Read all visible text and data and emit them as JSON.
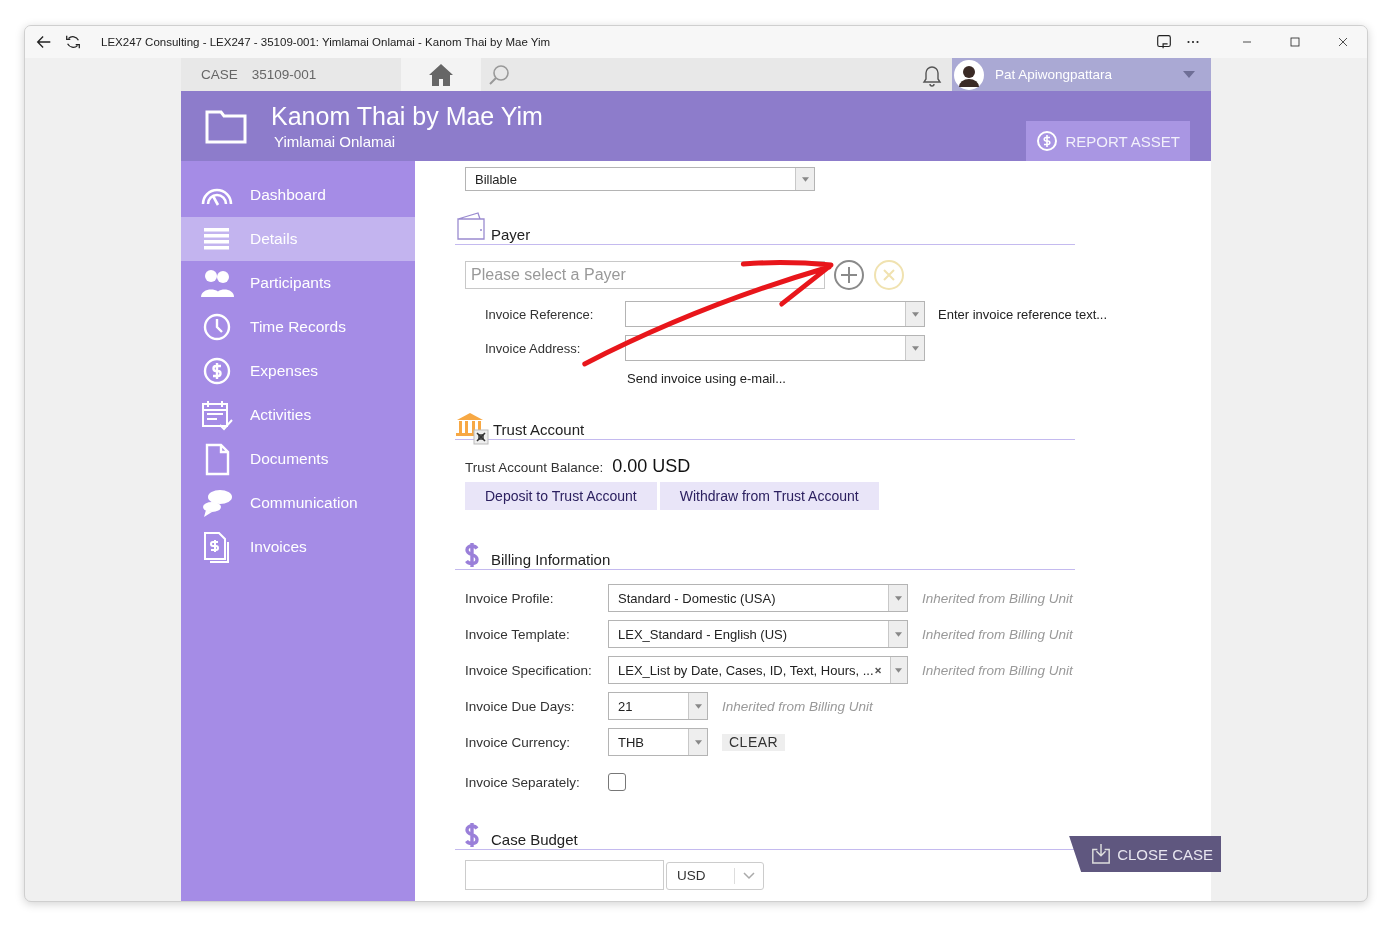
{
  "window": {
    "title": "LEX247 Consulting - LEX247 - 35109-001: Yimlamai Onlamai - Kanom Thai by Mae Yim"
  },
  "topbar": {
    "case_label": "CASE",
    "case_number": "35109-001",
    "user": "Pat Apiwongpattara"
  },
  "header": {
    "title": "Kanom Thai by Mae Yim",
    "subtitle": "Yimlamai Onlamai",
    "action": "REPORT ASSET"
  },
  "sidebar": {
    "items": [
      {
        "label": "Dashboard",
        "selected": false
      },
      {
        "label": "Details",
        "selected": true
      },
      {
        "label": "Participants",
        "selected": false
      },
      {
        "label": "Time Records",
        "selected": false
      },
      {
        "label": "Expenses",
        "selected": false
      },
      {
        "label": "Activities",
        "selected": false
      },
      {
        "label": "Documents",
        "selected": false
      },
      {
        "label": "Communication",
        "selected": false
      },
      {
        "label": "Invoices",
        "selected": false
      }
    ]
  },
  "billing_type": {
    "value": "Billable"
  },
  "payer": {
    "title": "Payer",
    "placeholder": "Please select a Payer",
    "fields": [
      {
        "label": "Invoice Reference:",
        "hint": "Enter invoice reference text..."
      },
      {
        "label": "Invoice Address:"
      }
    ],
    "email_link": "Send invoice using e-mail..."
  },
  "trust": {
    "title": "Trust Account",
    "balance_label": "Trust Account Balance:",
    "balance": "0.00 USD",
    "buttons": [
      "Deposit to Trust Account",
      "Withdraw from Trust Account"
    ]
  },
  "billing": {
    "title": "Billing Information",
    "rows": [
      {
        "kind": "wide",
        "label": "Invoice Profile:",
        "value": "Standard - Domestic (USA)",
        "note": "Inherited from Billing Unit"
      },
      {
        "kind": "wide",
        "label": "Invoice Template:",
        "value": "LEX_Standard - English (US)",
        "note": "Inherited from Billing Unit"
      },
      {
        "kind": "wide_clear",
        "label": "Invoice Specification:",
        "value": "LEX_List by Date, Cases, ID, Text, Hours, ...",
        "note": "Inherited from Billing Unit"
      },
      {
        "kind": "short",
        "label": "Invoice Due Days:",
        "value": "21",
        "note": "Inherited from Billing Unit"
      },
      {
        "kind": "short_action",
        "label": "Invoice Currency:",
        "value": "THB",
        "action": "CLEAR"
      },
      {
        "kind": "checkbox",
        "label": "Invoice Separately:",
        "checked": false
      }
    ]
  },
  "budget": {
    "title": "Case Budget",
    "currency": "USD"
  },
  "close_case": "CLOSE CASE"
}
